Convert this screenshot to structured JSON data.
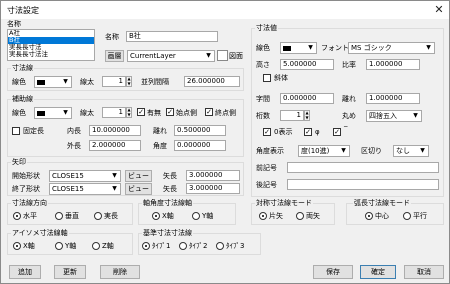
{
  "window": {
    "title": "寸法設定",
    "close_glyph": "✕"
  },
  "name_section": {
    "label": "名称",
    "list_items": [
      "A社",
      "B社",
      "実長長寸法",
      "実長長寸法注"
    ],
    "selected_index": 1,
    "name_label": "名称",
    "name_value": "B社",
    "layer_button": "画層",
    "layer_value": "CurrentLayer",
    "layer_icon_label": "図面"
  },
  "dimline": {
    "title": "寸法線",
    "color_label": "線色",
    "color_value": "■■",
    "width_label": "線太",
    "width_value": "1",
    "spacing_label": "並列間隔",
    "spacing_value": "26.000000"
  },
  "auxline": {
    "title": "補助線",
    "color_label": "線色",
    "color_value": "■■",
    "width_label": "線太",
    "width_value": "1",
    "enabled_label": "有無",
    "start_label": "始点側",
    "end_label": "終点側",
    "fixed_label": "固定長",
    "inner_label": "内長",
    "inner_value": "10.000000",
    "gap_label": "離れ",
    "gap_value": "0.500000",
    "outer_label": "外長",
    "outer_value": "2.000000",
    "angle_label": "角度",
    "angle_value": "0.000000"
  },
  "arrow": {
    "title": "矢印",
    "start_label": "開始形状",
    "start_value": "CLOSE15",
    "end_label": "終了形状",
    "end_value": "CLOSE15",
    "preview_label": "ビュー",
    "length_label": "矢長",
    "start_length": "3.000000",
    "end_length": "3.000000"
  },
  "dimvalue": {
    "title": "寸法値",
    "color_label": "線色",
    "color_value": "■■",
    "font_label": "フォント",
    "font_value": "MS ゴシック",
    "height_label": "高さ",
    "height_value": "5.000000",
    "ratio_label": "比率",
    "ratio_value": "1.000000",
    "italic_label": "斜体",
    "spacing_label": "字間",
    "spacing_value": "0.000000",
    "offset_label": "離れ",
    "offset_value": "1.000000",
    "digits_label": "桁数",
    "digits_value": "1",
    "round_label": "丸め",
    "round_value": "四捨五入",
    "zero_label": "0表示",
    "phi_label": "φ",
    "extra_label": "‾",
    "angle_label": "角度表示",
    "angle_value": "度(10進)",
    "separator_label": "区切り",
    "separator_value": "なし",
    "prefix_label": "前記号",
    "suffix_label": "後記号"
  },
  "direction": {
    "title": "寸法線方向",
    "options": [
      "水平",
      "垂直",
      "実長"
    ],
    "selected": 0
  },
  "axis_dir": {
    "title": "軸角度寸法線軸",
    "options": [
      "X軸",
      "Y軸"
    ],
    "selected": 0
  },
  "symmetric": {
    "title": "対称寸法線モード",
    "options": [
      "片矢",
      "両矢"
    ],
    "selected": 0
  },
  "arc_mode": {
    "title": "弧長寸法線モード",
    "options": [
      "中心",
      "平行"
    ],
    "selected": 0
  },
  "iso_axis": {
    "title": "アイソメ寸法線軸",
    "options": [
      "X軸",
      "Y軸",
      "Z軸"
    ],
    "selected": 0
  },
  "base_type": {
    "title": "基準寸法寸法線",
    "options": [
      "ﾀｲﾌﾟ1",
      "ﾀｲﾌﾟ2",
      "ﾀｲﾌﾟ3"
    ],
    "selected": 0
  },
  "buttons": {
    "add": "追加",
    "update": "更新",
    "delete": "削除",
    "save": "保存",
    "ok": "確定",
    "cancel": "取消"
  }
}
